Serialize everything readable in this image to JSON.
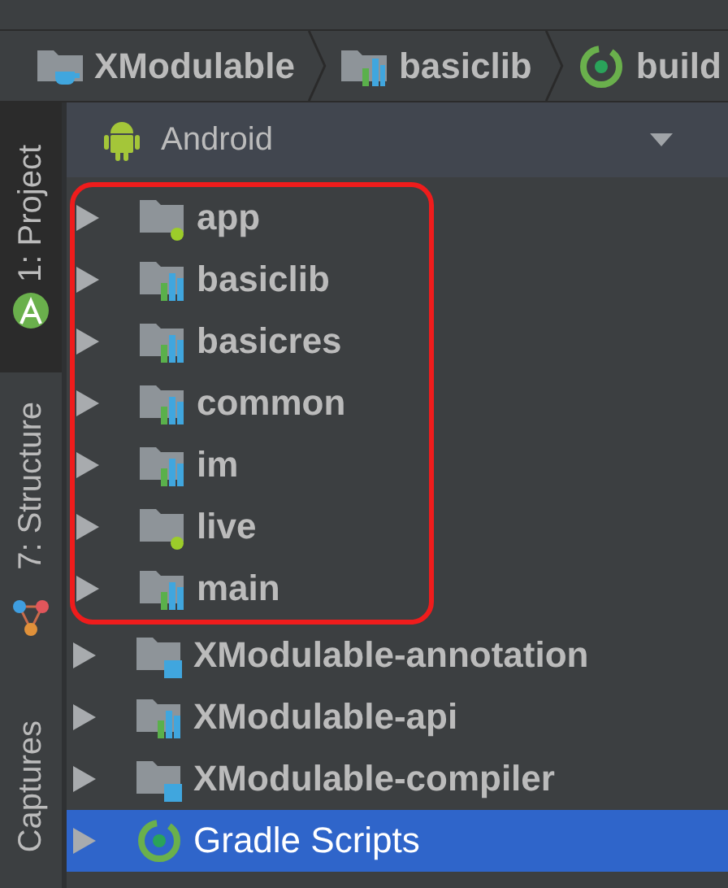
{
  "breadcrumb": [
    {
      "label": "XModulable",
      "kind": "project"
    },
    {
      "label": "basiclib",
      "kind": "lib"
    },
    {
      "label": "build",
      "kind": "gradle"
    }
  ],
  "sidebar": [
    {
      "label": "1: Project",
      "selected": true,
      "kind": "android"
    },
    {
      "label": "7: Structure",
      "selected": false,
      "kind": "plain"
    },
    {
      "label": "Captures",
      "selected": false,
      "kind": "captures"
    }
  ],
  "view_selector": {
    "label": "Android"
  },
  "tree_groups": [
    {
      "framed": true,
      "items": [
        {
          "label": "app",
          "kind": "app",
          "selected": false
        },
        {
          "label": "basiclib",
          "kind": "lib",
          "selected": false
        },
        {
          "label": "basicres",
          "kind": "lib",
          "selected": false
        },
        {
          "label": "common",
          "kind": "lib",
          "selected": false
        },
        {
          "label": "im",
          "kind": "lib",
          "selected": false
        },
        {
          "label": "live",
          "kind": "app",
          "selected": false
        },
        {
          "label": "main",
          "kind": "lib",
          "selected": false
        }
      ]
    },
    {
      "items": [
        {
          "label": "XModulable-annotation",
          "kind": "java",
          "selected": false
        },
        {
          "label": "XModulable-api",
          "kind": "lib",
          "selected": false
        },
        {
          "label": "XModulable-compiler",
          "kind": "java",
          "selected": false
        },
        {
          "label": "Gradle Scripts",
          "kind": "gradle",
          "selected": true
        }
      ]
    }
  ]
}
